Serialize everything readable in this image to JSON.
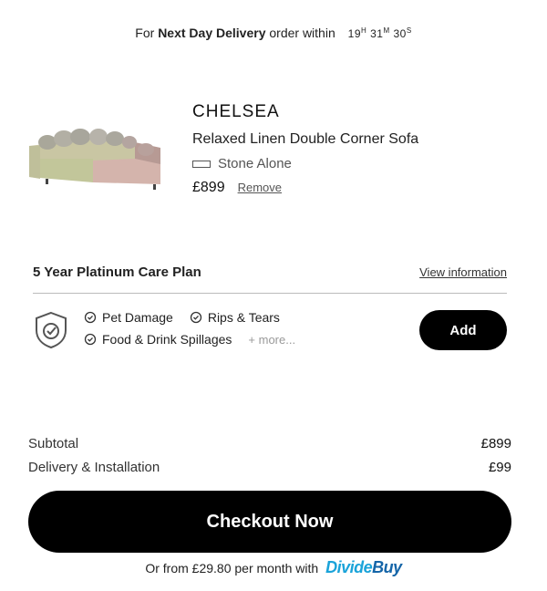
{
  "delivery": {
    "prefix": "For",
    "bold": "Next Day Delivery",
    "suffix": "order within",
    "timer": {
      "hours": "19",
      "h_unit": "H",
      "minutes": "31",
      "m_unit": "M",
      "seconds": "30",
      "s_unit": "S"
    }
  },
  "product": {
    "brand": "CHELSEA",
    "name": "Relaxed Linen Double Corner Sofa",
    "variant": "Stone Alone",
    "price": "£899",
    "remove_label": "Remove"
  },
  "care_plan": {
    "title": "5 Year Platinum Care Plan",
    "link_label": "View information",
    "features": [
      "Pet Damage",
      "Rips & Tears",
      "Food & Drink Spillages"
    ],
    "more_label": "+ more...",
    "add_label": "Add"
  },
  "totals": {
    "subtotal_label": "Subtotal",
    "subtotal_value": "£899",
    "delivery_label": "Delivery & Installation",
    "delivery_value": "£99"
  },
  "checkout": {
    "label": "Checkout Now"
  },
  "finance": {
    "text": "Or from £29.80 per month with",
    "logo_part1": "Divide",
    "logo_part2": "Buy"
  },
  "colors": {
    "accent_blue": "#1aa3d9",
    "accent_dark_blue": "#1565a8",
    "button_bg": "#000000"
  }
}
